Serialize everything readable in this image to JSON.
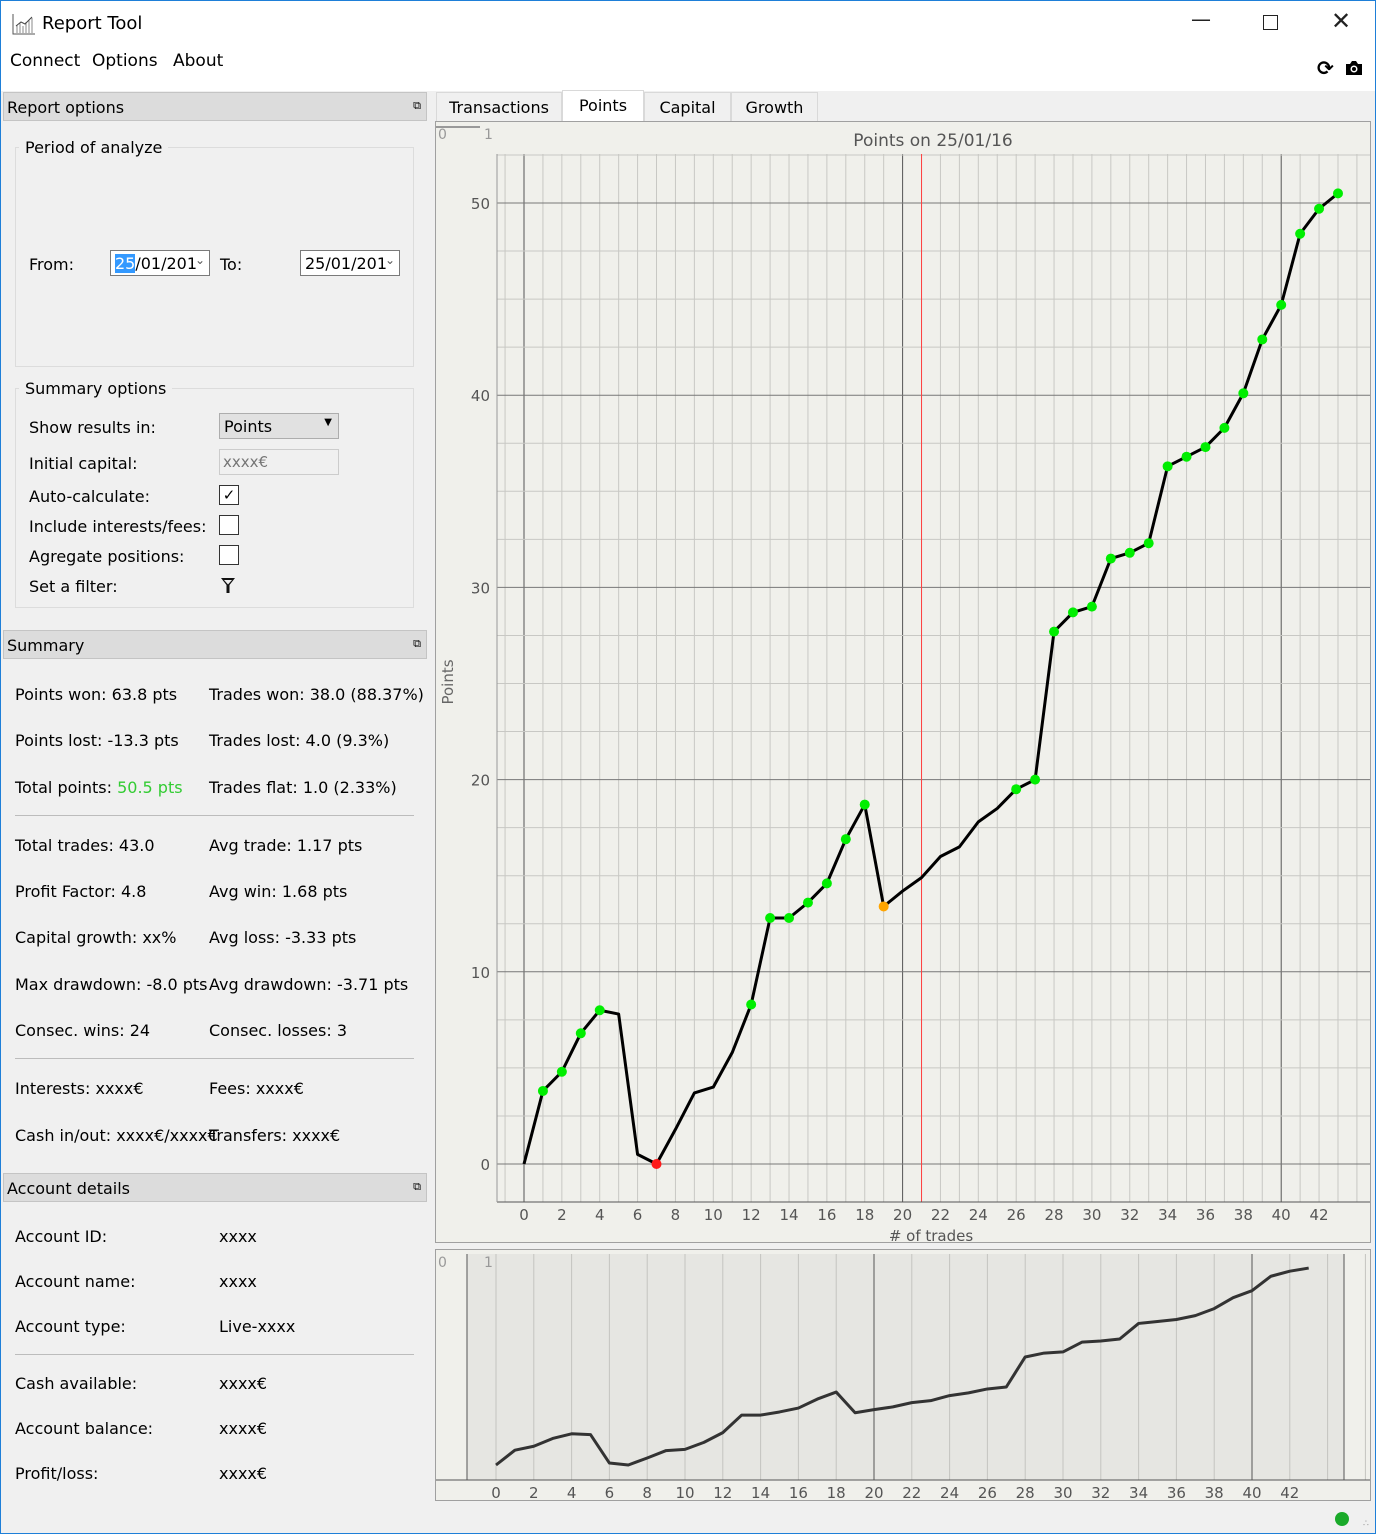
{
  "window": {
    "title": "Report Tool",
    "icon": "chart-app-icon",
    "controls": [
      "minimize",
      "maximize",
      "close"
    ]
  },
  "menu": [
    "Connect",
    "Options",
    "About"
  ],
  "toolbar_icons": [
    "refresh-icon",
    "camera-icon"
  ],
  "report_options": {
    "title": "Report options",
    "period": {
      "title": "Period of analyze",
      "from_label": "From:",
      "from_sel": "25",
      "from_rest": "/01/201",
      "to_label": "To:",
      "to_value": "25/01/201"
    },
    "summary_options": {
      "title": "Summary options",
      "show_results_label": "Show results in:",
      "show_results_value": "Points",
      "initial_capital_label": "Initial capital:",
      "initial_capital_placeholder": "xxxx€",
      "auto_calc_label": "Auto-calculate:",
      "auto_calc_checked": true,
      "include_fees_label": "Include interests/fees:",
      "include_fees_checked": false,
      "aggregate_label": "Agregate positions:",
      "aggregate_checked": false,
      "filter_label": "Set a filter:"
    }
  },
  "summary": {
    "title": "Summary",
    "points_won": "Points won: 63.8 pts",
    "trades_won": "Trades won: 38.0 (88.37%)",
    "points_lost": "Points lost: -13.3 pts",
    "trades_lost": "Trades lost: 4.0 (9.3%)",
    "total_points_label": "Total points: ",
    "total_points_value": "50.5 pts",
    "trades_flat": "Trades flat: 1.0 (2.33%)",
    "total_trades": "Total trades: 43.0",
    "avg_trade": "Avg trade: 1.17 pts",
    "profit_factor": "Profit Factor: 4.8",
    "avg_win": "Avg win: 1.68 pts",
    "capital_growth": "Capital growth: xx%",
    "avg_loss": "Avg loss: -3.33 pts",
    "max_drawdown": "Max drawdown: -8.0 pts",
    "avg_drawdown": "Avg drawdown: -3.71 pts",
    "consec_wins": "Consec. wins: 24",
    "consec_losses": "Consec. losses: 3",
    "interests": "Interests: xxxx€",
    "fees": "Fees: xxxx€",
    "cash_inout": "Cash in/out: xxxx€/xxxx€",
    "transfers": "Transfers: xxxx€"
  },
  "account": {
    "title": "Account details",
    "rows": [
      {
        "label": "Account ID:",
        "value": "xxxx"
      },
      {
        "label": "Account name:",
        "value": "xxxx"
      },
      {
        "label": "Account type:",
        "value": "Live-xxxx"
      },
      {
        "label": "Cash available:",
        "value": "xxxx€"
      },
      {
        "label": "Account balance:",
        "value": "xxxx€"
      },
      {
        "label": "Profit/loss:",
        "value": "xxxx€"
      }
    ]
  },
  "tabs": [
    "Transactions",
    "Points",
    "Capital",
    "Growth"
  ],
  "active_tab": 1,
  "colors": {
    "win": "#00ee00",
    "loss": "#ff1a1a",
    "flat": "#ffa500",
    "positive_text": "#33cc33",
    "cursor": "#ff4040",
    "status_ok": "#1aaa2a"
  },
  "chart_data": [
    {
      "type": "line",
      "title": "Points on 25/01/16",
      "xlabel": "# of trades",
      "ylabel": "Points",
      "corner_labels": [
        "0",
        "1"
      ],
      "xlim": [
        -1.5,
        44.5
      ],
      "ylim": [
        -2,
        54
      ],
      "xticks": [
        0,
        2,
        4,
        6,
        8,
        10,
        12,
        14,
        16,
        18,
        20,
        22,
        24,
        26,
        28,
        30,
        32,
        34,
        36,
        38,
        40,
        42
      ],
      "yticks": [
        0,
        10,
        20,
        30,
        40,
        50
      ],
      "cursor_x": 21,
      "x": [
        0,
        1,
        2,
        3,
        4,
        5,
        6,
        7,
        8,
        9,
        10,
        11,
        12,
        13,
        14,
        15,
        16,
        17,
        18,
        19,
        20,
        21,
        22,
        23,
        24,
        25,
        26,
        27,
        28,
        29,
        30,
        31,
        32,
        33,
        34,
        35,
        36,
        37,
        38,
        39,
        40,
        41,
        42,
        43
      ],
      "y": [
        0,
        3.8,
        4.8,
        6.8,
        8.0,
        7.8,
        0.5,
        0,
        1.8,
        3.7,
        4.0,
        5.8,
        8.3,
        12.8,
        12.8,
        13.6,
        14.6,
        16.9,
        18.7,
        13.4,
        14.2,
        14.9,
        16.0,
        16.5,
        17.8,
        18.5,
        19.5,
        20.0,
        27.7,
        28.7,
        29.0,
        31.5,
        31.8,
        32.3,
        36.3,
        36.8,
        37.3,
        38.3,
        40.1,
        42.9,
        44.7,
        48.4,
        49.7,
        50.5
      ],
      "markers": [
        "",
        "win",
        "win",
        "win",
        "win",
        "",
        "",
        "loss",
        "",
        "",
        "",
        "",
        "win",
        "win",
        "win",
        "win",
        "win",
        "win",
        "win",
        "flat",
        "",
        "",
        "",
        "",
        "",
        "",
        "win",
        "win",
        "win",
        "win",
        "win",
        "win",
        "win",
        "win",
        "win",
        "win",
        "win",
        "win",
        "win",
        "win",
        "win",
        "win",
        "win",
        "win"
      ]
    },
    {
      "type": "line",
      "title": "overview",
      "corner_labels": [
        "0",
        "1"
      ],
      "xticks": [
        0,
        2,
        4,
        6,
        8,
        10,
        12,
        14,
        16,
        18,
        20,
        22,
        24,
        26,
        28,
        30,
        32,
        34,
        36,
        38,
        40,
        42
      ],
      "series_ref": "same as main chart y"
    }
  ]
}
